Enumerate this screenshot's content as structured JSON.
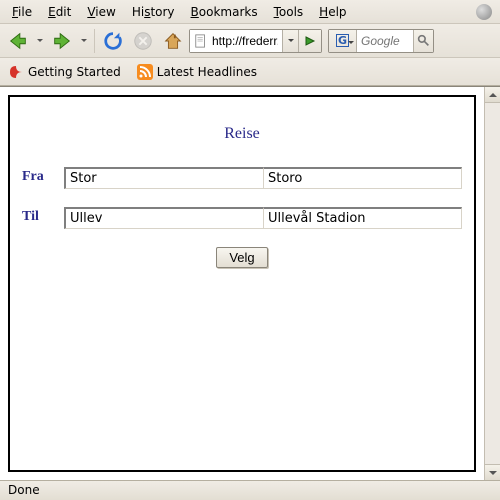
{
  "menubar": {
    "file": "File",
    "edit": "Edit",
    "view": "View",
    "history": "History",
    "bookmarks": "Bookmarks",
    "tools": "Tools",
    "help": "Help"
  },
  "toolbar": {
    "url": "http://frederr.",
    "search_placeholder": "Google"
  },
  "bookmarks_bar": {
    "getting_started": "Getting Started",
    "latest_headlines": "Latest Headlines"
  },
  "page": {
    "title": "Reise",
    "from_label": "Fra",
    "to_label": "Til",
    "from_value": "Stor",
    "from_suggestion": "Storo",
    "to_value": "Ullev",
    "to_suggestion": "Ullevål Stadion",
    "submit": "Velg"
  },
  "status": "Done"
}
